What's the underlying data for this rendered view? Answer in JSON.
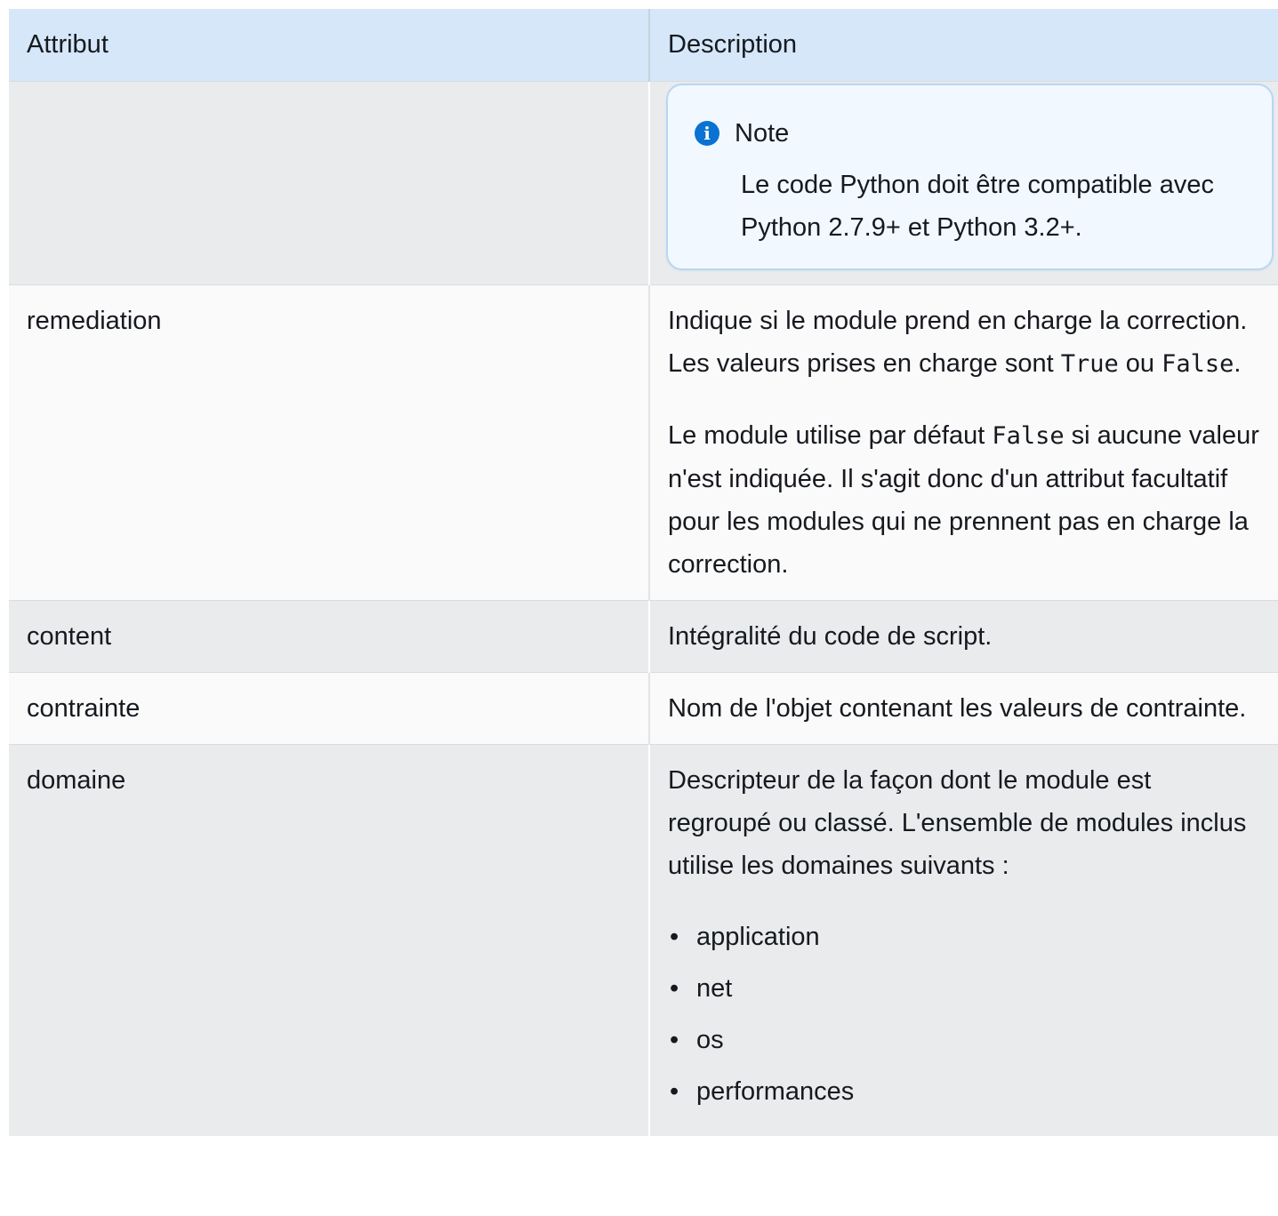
{
  "table": {
    "headers": {
      "attribute": "Attribut",
      "description": "Description"
    },
    "note": {
      "title": "Note",
      "icon": "info-icon",
      "body": "Le code Python doit être compatible avec Python 2.7.9+ et Python 3.2+."
    },
    "rows": {
      "remediation": {
        "name": "remediation",
        "p1_pre": "Indique si le module prend en charge la correction. Les valeurs prises en charge sont ",
        "p1_code1": "True",
        "p1_mid": " ou ",
        "p1_code2": "False",
        "p1_post": ".",
        "p2_pre": "Le module utilise par défaut ",
        "p2_code": "False",
        "p2_post": " si aucune valeur n'est indiquée. Il s'agit donc d'un attribut facultatif pour les modules qui ne prennent pas en charge la correction."
      },
      "content": {
        "name": "content",
        "description": "Intégralité du code de script."
      },
      "contrainte": {
        "name": "contrainte",
        "description": "Nom de l'objet contenant les valeurs de contrainte."
      },
      "domaine": {
        "name": "domaine",
        "description": "Descripteur de la façon dont le module est regroupé ou classé. L'ensemble de modules inclus utilise les domaines suivants :",
        "items": [
          "application",
          "net",
          "os",
          "performances"
        ]
      }
    }
  },
  "colors": {
    "header_bg": "#d5e7f8",
    "row_odd_bg": "#e9ebed",
    "row_even_bg": "#fafafa",
    "note_bg": "#f1f8ff",
    "note_border": "#b7d7f3",
    "info_icon": "#0972d3"
  }
}
